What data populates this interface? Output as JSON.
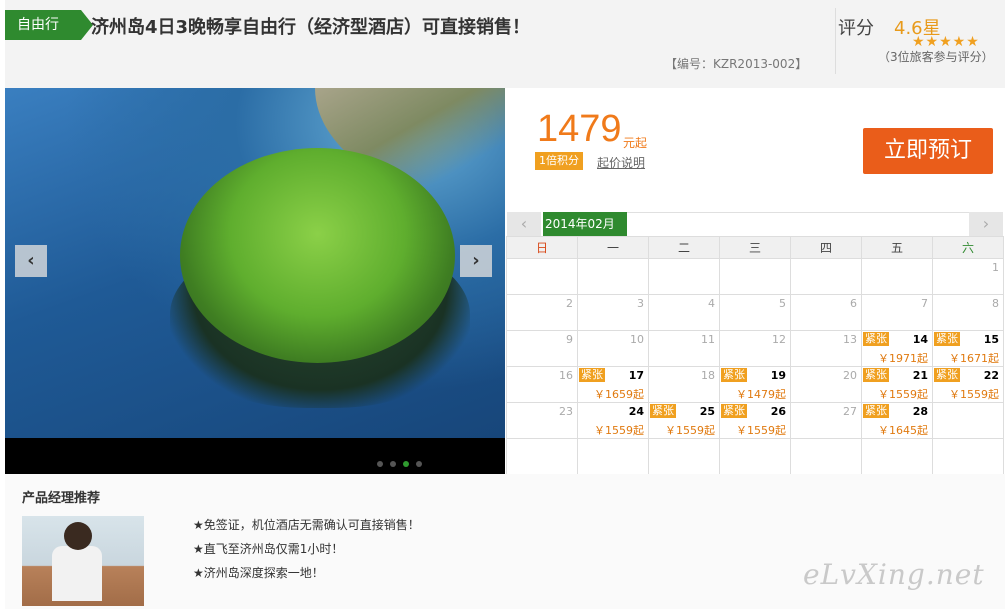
{
  "header": {
    "tag": "自由行",
    "title": "济州岛4日3晚畅享自由行（经济型酒店）可直接销售！",
    "code": "【编号：KZR2013-002】",
    "rating_label": "评分",
    "rating_value": "4.6星",
    "stars": "★★★★★",
    "reviews": "（3位旅客参与评分）"
  },
  "gallery": {
    "prev_icon": "‹",
    "next_icon": "›",
    "dots": 4,
    "active_dot": 2
  },
  "pricing": {
    "price": "1479",
    "unit": "元起",
    "points_badge": "1倍积分",
    "note": "起价说明",
    "book_label": "立即预订"
  },
  "calendar": {
    "month": "2014年02月",
    "prev_icon": "‹",
    "next_icon": "›",
    "weekdays": [
      "日",
      "一",
      "二",
      "三",
      "四",
      "五",
      "六"
    ],
    "weeks": [
      [
        null,
        null,
        null,
        null,
        null,
        null,
        {
          "d": "1"
        }
      ],
      [
        {
          "d": "2"
        },
        {
          "d": "3"
        },
        {
          "d": "4"
        },
        {
          "d": "5"
        },
        {
          "d": "6"
        },
        {
          "d": "7"
        },
        {
          "d": "8"
        }
      ],
      [
        {
          "d": "9"
        },
        {
          "d": "10"
        },
        {
          "d": "11"
        },
        {
          "d": "12"
        },
        {
          "d": "13"
        },
        {
          "d": "14",
          "tight": "紧张",
          "price": "￥1971起"
        },
        {
          "d": "15",
          "tight": "紧张",
          "price": "￥1671起"
        }
      ],
      [
        {
          "d": "16"
        },
        {
          "d": "17",
          "tight": "紧张",
          "price": "￥1659起"
        },
        {
          "d": "18"
        },
        {
          "d": "19",
          "tight": "紧张",
          "price": "￥1479起"
        },
        {
          "d": "20"
        },
        {
          "d": "21",
          "tight": "紧张",
          "price": "￥1559起"
        },
        {
          "d": "22",
          "tight": "紧张",
          "price": "￥1559起"
        }
      ],
      [
        {
          "d": "23"
        },
        {
          "d": "24",
          "price": "￥1559起"
        },
        {
          "d": "25",
          "tight": "紧张",
          "price": "￥1559起"
        },
        {
          "d": "26",
          "tight": "紧张",
          "price": "￥1559起"
        },
        {
          "d": "27"
        },
        {
          "d": "28",
          "tight": "紧张",
          "price": "￥1645起"
        },
        null
      ],
      [
        null,
        null,
        null,
        null,
        null,
        null,
        null
      ]
    ]
  },
  "recommend": {
    "title": "产品经理推荐",
    "items": [
      "★免签证，机位酒店无需确认可直接销售！",
      "★直飞至济州岛仅需1小时！",
      "★济州岛深度探索一地！"
    ],
    "watermark": "eLvXing.net"
  }
}
